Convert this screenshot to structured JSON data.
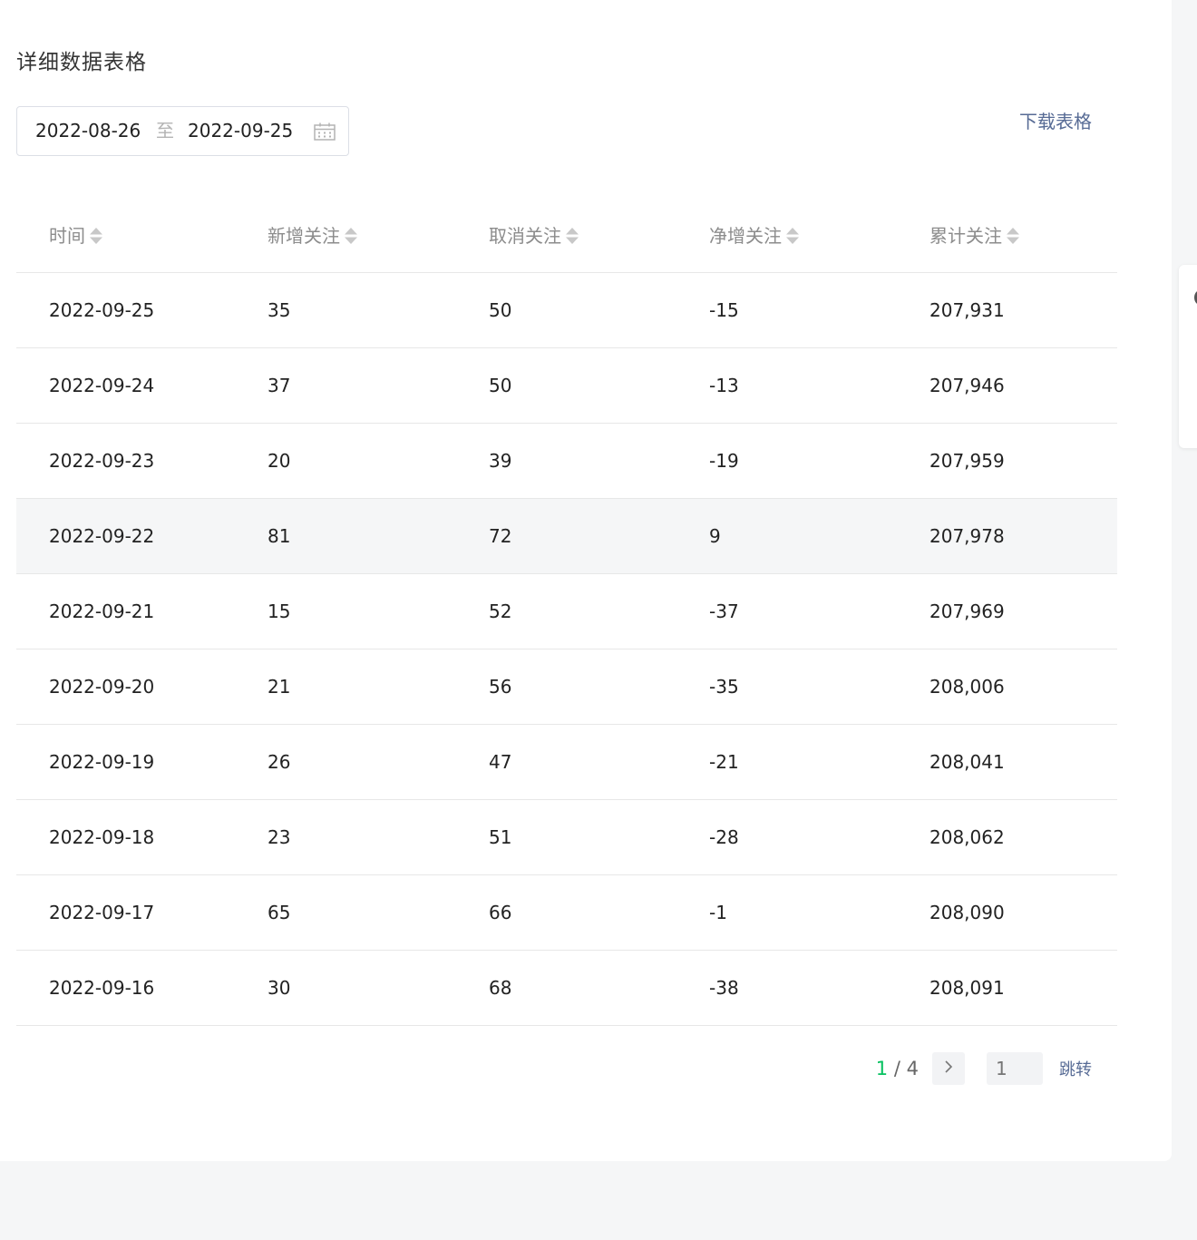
{
  "section_title": "详细数据表格",
  "date_range": {
    "start": "2022-08-26",
    "separator": "至",
    "end": "2022-09-25"
  },
  "download_label": "下载表格",
  "table": {
    "columns": [
      "时间",
      "新增关注",
      "取消关注",
      "净增关注",
      "累计关注"
    ],
    "rows": [
      [
        "2022-09-25",
        "35",
        "50",
        "-15",
        "207,931"
      ],
      [
        "2022-09-24",
        "37",
        "50",
        "-13",
        "207,946"
      ],
      [
        "2022-09-23",
        "20",
        "39",
        "-19",
        "207,959"
      ],
      [
        "2022-09-22",
        "81",
        "72",
        "9",
        "207,978"
      ],
      [
        "2022-09-21",
        "15",
        "52",
        "-37",
        "207,969"
      ],
      [
        "2022-09-20",
        "21",
        "56",
        "-35",
        "208,006"
      ],
      [
        "2022-09-19",
        "26",
        "47",
        "-21",
        "208,041"
      ],
      [
        "2022-09-18",
        "23",
        "51",
        "-28",
        "208,062"
      ],
      [
        "2022-09-17",
        "65",
        "66",
        "-1",
        "208,090"
      ],
      [
        "2022-09-16",
        "30",
        "68",
        "-38",
        "208,091"
      ]
    ],
    "hovered_row": 3
  },
  "pagination": {
    "current": "1",
    "separator": "/",
    "total": "4",
    "input_placeholder": "1",
    "jump_label": "跳转"
  },
  "colors": {
    "accent_green": "#07c160",
    "link_blue": "#576b95"
  }
}
